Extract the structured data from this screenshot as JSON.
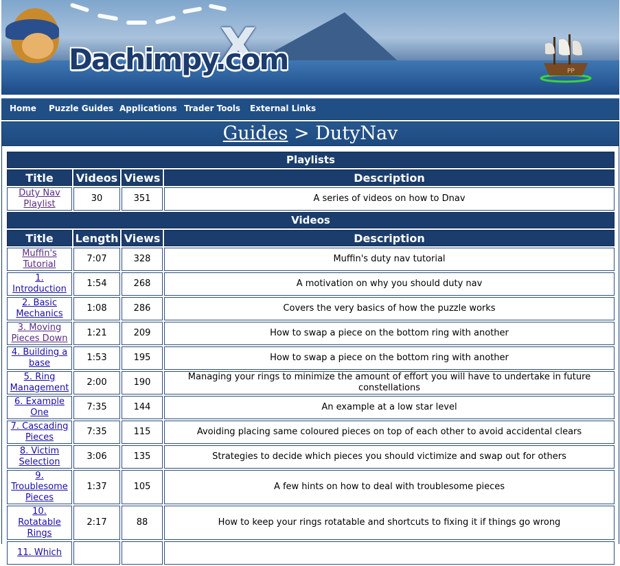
{
  "banner": {
    "logo_text": "Dachimpy.com",
    "logo_x": "X",
    "ship_flag": "PP"
  },
  "nav": {
    "items": [
      {
        "label": "Home"
      },
      {
        "label": "Puzzle Guides"
      },
      {
        "label": "Applications"
      },
      {
        "label": "Trader Tools"
      },
      {
        "label": "External Links"
      }
    ]
  },
  "title": {
    "breadcrumb_link": "Guides",
    "separator": ">",
    "current": "DutyNav"
  },
  "playlists": {
    "section_label": "Playlists",
    "columns": [
      "Title",
      "Videos",
      "Views",
      "Description"
    ],
    "rows": [
      {
        "title": "Duty Nav Playlist",
        "count": "30",
        "views": "351",
        "description": "A series of videos on how to Dnav"
      }
    ]
  },
  "videos": {
    "section_label": "Videos",
    "columns": [
      "Title",
      "Length",
      "Views",
      "Description"
    ],
    "rows": [
      {
        "title": "Muffin's Tutorial",
        "length": "7:07",
        "views": "328",
        "description": "Muffin's duty nav tutorial"
      },
      {
        "title": "1. Introduction",
        "length": "1:54",
        "views": "268",
        "description": "A motivation on why you should duty nav"
      },
      {
        "title": "2. Basic Mechanics",
        "length": "1:08",
        "views": "286",
        "description": "Covers the very basics of how the puzzle works"
      },
      {
        "title": "3. Moving Pieces Down",
        "length": "1:21",
        "views": "209",
        "description": "How to swap a piece on the bottom ring with another"
      },
      {
        "title": "4. Building a base",
        "length": "1:53",
        "views": "195",
        "description": "How to swap a piece on the bottom ring with another"
      },
      {
        "title": "5. Ring Management",
        "length": "2:00",
        "views": "190",
        "description": "Managing your rings to minimize the amount of effort you will have to undertake in future constellations"
      },
      {
        "title": "6. Example One",
        "length": "7:35",
        "views": "144",
        "description": "An example at a low star level"
      },
      {
        "title": "7. Cascading Pieces",
        "length": "7:35",
        "views": "115",
        "description": "Avoiding placing same coloured pieces on top of each other to avoid accidental clears"
      },
      {
        "title": "8. Victim Selection",
        "length": "3:06",
        "views": "135",
        "description": "Strategies to decide which pieces you should victimize and swap out for others"
      },
      {
        "title": "9. Troublesome Pieces",
        "length": "1:37",
        "views": "105",
        "description": "A few hints on how to deal with troublesome pieces"
      },
      {
        "title": "10. Rotatable Rings",
        "length": "2:17",
        "views": "88",
        "description": "How to keep your rings rotatable and shortcuts to fixing it if things go wrong"
      },
      {
        "title": "11. Which",
        "length": "",
        "views": "",
        "description": ""
      }
    ]
  },
  "colors": {
    "nav_bg": "#204f86",
    "header_bg": "#1b3d6d",
    "link": "#1a0dab",
    "visited_link": "#5a2a82"
  }
}
